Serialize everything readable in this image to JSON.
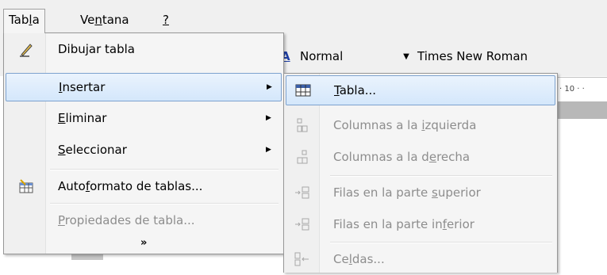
{
  "menubar": {
    "items": [
      {
        "label_pre": "Tab",
        "mnemonic": "l",
        "label_post": "a"
      },
      {
        "label_pre": "Ve",
        "mnemonic": "n",
        "label_post": "tana"
      },
      {
        "label_pre": "",
        "mnemonic": "?",
        "label_post": ""
      }
    ]
  },
  "toolbar": {
    "style_icon": "A",
    "style_value": "Normal",
    "font_value": "Times New Roman",
    "ruler_text": "· 10 · ·"
  },
  "tabla_menu": {
    "items": [
      {
        "pre": "",
        "mn": "",
        "post": "Dibujar tabla",
        "icon": "pencil-icon",
        "submenu": false,
        "disabled": false
      },
      {
        "pre": "",
        "mn": "I",
        "post": "nsertar",
        "icon": "",
        "submenu": true,
        "disabled": false,
        "highlighted": true
      },
      {
        "pre": "",
        "mn": "E",
        "post": "liminar",
        "icon": "",
        "submenu": true,
        "disabled": false
      },
      {
        "pre": "",
        "mn": "S",
        "post": "eleccionar",
        "icon": "",
        "submenu": true,
        "disabled": false
      },
      {
        "pre": "Auto",
        "mn": "f",
        "post": "ormato de tablas...",
        "icon": "table-autoformat-icon",
        "submenu": false,
        "disabled": false
      },
      {
        "pre": "",
        "mn": "P",
        "post": "ropiedades de tabla...",
        "icon": "",
        "submenu": false,
        "disabled": true
      }
    ],
    "expand_glyph": "»"
  },
  "insertar_submenu": {
    "items": [
      {
        "pre": "",
        "mn": "T",
        "post": "abla...",
        "icon": "table-icon",
        "disabled": false,
        "highlighted": true
      },
      {
        "pre": "Columnas a la ",
        "mn": "i",
        "post": "zquierda",
        "icon": "insert-columns-left-icon",
        "disabled": true
      },
      {
        "pre": "Columnas a la d",
        "mn": "e",
        "post": "recha",
        "icon": "insert-columns-right-icon",
        "disabled": true
      },
      {
        "pre": "Filas en la parte ",
        "mn": "s",
        "post": "uperior",
        "icon": "insert-rows-above-icon",
        "disabled": true
      },
      {
        "pre": "Filas en la parte in",
        "mn": "f",
        "post": "erior",
        "icon": "insert-rows-below-icon",
        "disabled": true
      },
      {
        "pre": "Ce",
        "mn": "l",
        "post": "das...",
        "icon": "insert-cells-icon",
        "disabled": true
      }
    ]
  }
}
